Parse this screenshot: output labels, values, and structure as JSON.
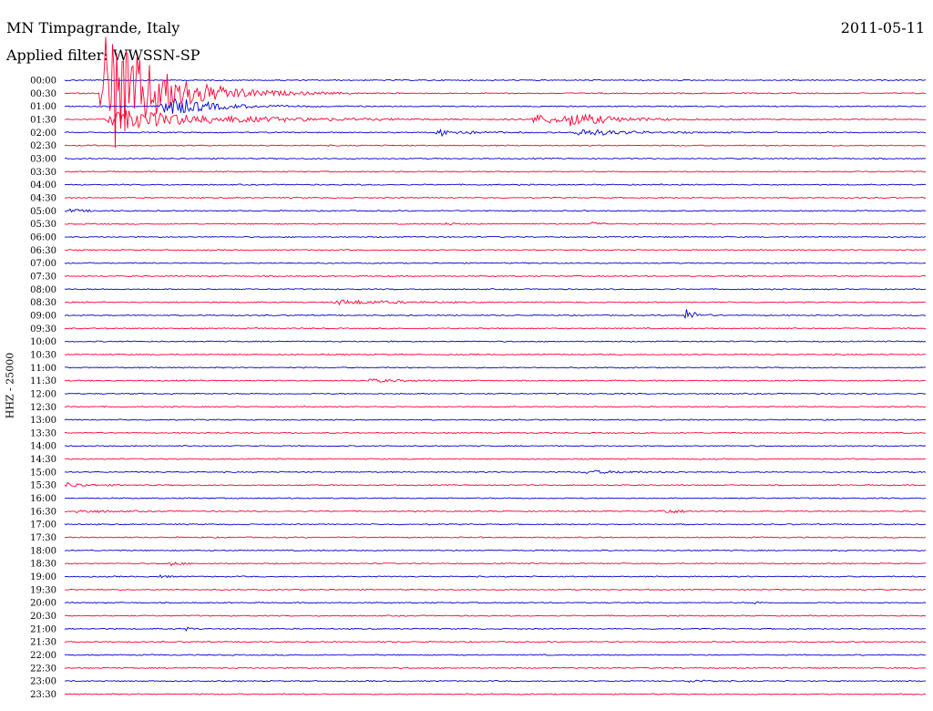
{
  "header": {
    "station": "MN Timpagrande, Italy",
    "filter": "Applied filter: WWSSN-SP",
    "date": "2011-05-11"
  },
  "chart_data": {
    "type": "line",
    "ylabel": "HHZ - 25000",
    "y_tick_labels": [
      "00:00",
      "00:30",
      "01:00",
      "01:30",
      "02:00",
      "02:30",
      "03:00",
      "03:30",
      "04:00",
      "04:30",
      "05:00",
      "05:30",
      "06:00",
      "06:30",
      "07:00",
      "07:30",
      "08:00",
      "08:30",
      "09:00",
      "09:30",
      "10:00",
      "10:30",
      "11:00",
      "11:30",
      "12:00",
      "12:30",
      "13:00",
      "13:30",
      "14:00",
      "14:30",
      "15:00",
      "15:30",
      "16:00",
      "16:30",
      "17:00",
      "17:30",
      "18:00",
      "18:30",
      "19:00",
      "19:30",
      "20:00",
      "20:30",
      "21:00",
      "21:30",
      "22:00",
      "22:30",
      "23:00",
      "23:30"
    ],
    "x_minutes_per_row": 30,
    "series_colors": [
      "#0000cc",
      "#ff0033"
    ],
    "events": [
      {
        "row": 1,
        "x": 0.04,
        "amp": 90,
        "dur": 0.05
      },
      {
        "row": 2,
        "x": 0.11,
        "amp": 14,
        "dur": 0.04
      },
      {
        "row": 3,
        "x": 0.046,
        "amp": 12,
        "dur": 0.1
      },
      {
        "row": 3,
        "x": 0.54,
        "amp": 6,
        "dur": 0.04
      },
      {
        "row": 3,
        "x": 0.58,
        "amp": 7,
        "dur": 0.04
      },
      {
        "row": 4,
        "x": 0.43,
        "amp": 4,
        "dur": 0.03
      },
      {
        "row": 4,
        "x": 0.59,
        "amp": 5,
        "dur": 0.04
      },
      {
        "row": 10,
        "x": 0.0,
        "amp": 2,
        "dur": 0.02
      },
      {
        "row": 11,
        "x": 0.44,
        "amp": 2,
        "dur": 0.01
      },
      {
        "row": 11,
        "x": 0.61,
        "amp": 2,
        "dur": 0.01
      },
      {
        "row": 17,
        "x": 0.31,
        "amp": 3,
        "dur": 0.05
      },
      {
        "row": 18,
        "x": 0.72,
        "amp": 8,
        "dur": 0.01
      },
      {
        "row": 23,
        "x": 0.35,
        "amp": 2,
        "dur": 0.03
      },
      {
        "row": 30,
        "x": 0.6,
        "amp": 2,
        "dur": 0.04
      },
      {
        "row": 31,
        "x": 0.0,
        "amp": 3,
        "dur": 0.02
      },
      {
        "row": 33,
        "x": 0.01,
        "amp": 2,
        "dur": 0.03
      },
      {
        "row": 33,
        "x": 0.69,
        "amp": 3,
        "dur": 0.02
      },
      {
        "row": 37,
        "x": 0.12,
        "amp": 3,
        "dur": 0.01
      },
      {
        "row": 38,
        "x": 0.11,
        "amp": 4,
        "dur": 0.005
      },
      {
        "row": 40,
        "x": 0.8,
        "amp": 2,
        "dur": 0.005
      },
      {
        "row": 42,
        "x": 0.14,
        "amp": 2,
        "dur": 0.006
      },
      {
        "row": 46,
        "x": 0.72,
        "amp": 1.5,
        "dur": 0.02
      }
    ]
  }
}
